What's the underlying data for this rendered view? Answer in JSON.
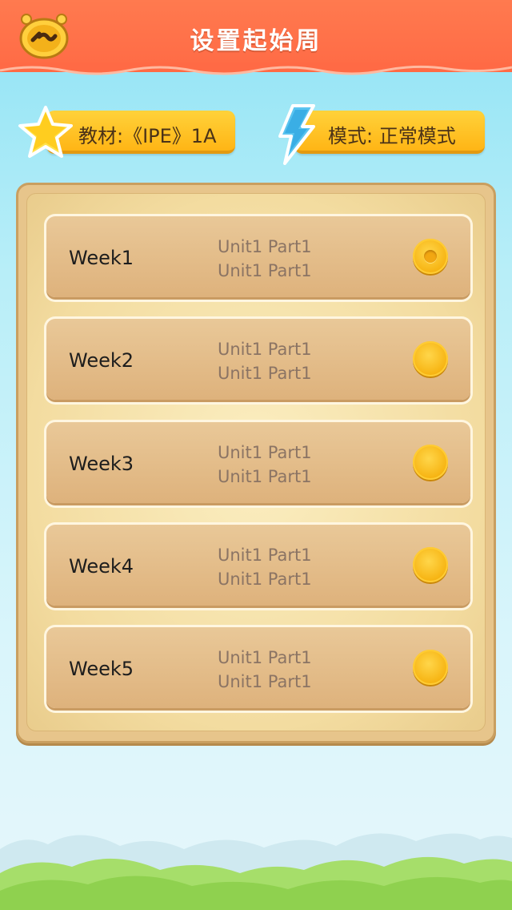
{
  "header": {
    "title": "设置起始周",
    "back_icon": "back-arrow-icon"
  },
  "info": {
    "textbook": "教材:《IPE》1A",
    "mode": "模式: 正常模式",
    "textbook_icon": "star-icon",
    "mode_icon": "lightning-icon"
  },
  "weeks": [
    {
      "label": "Week1",
      "line1": "Unit1 Part1",
      "line2": "Unit1 Part1",
      "selected": true
    },
    {
      "label": "Week2",
      "line1": "Unit1 Part1",
      "line2": "Unit1 Part1",
      "selected": false
    },
    {
      "label": "Week3",
      "line1": "Unit1 Part1",
      "line2": "Unit1 Part1",
      "selected": false
    },
    {
      "label": "Week4",
      "line1": "Unit1 Part1",
      "line2": "Unit1 Part1",
      "selected": false
    },
    {
      "label": "Week5",
      "line1": "Unit1 Part1",
      "line2": "Unit1 Part1",
      "selected": false
    }
  ],
  "colors": {
    "header": "#ff6a45",
    "sky": "#8fe3f5",
    "pill": "#ffc527",
    "board": "#e7c58b",
    "radio": "#f7b514"
  }
}
